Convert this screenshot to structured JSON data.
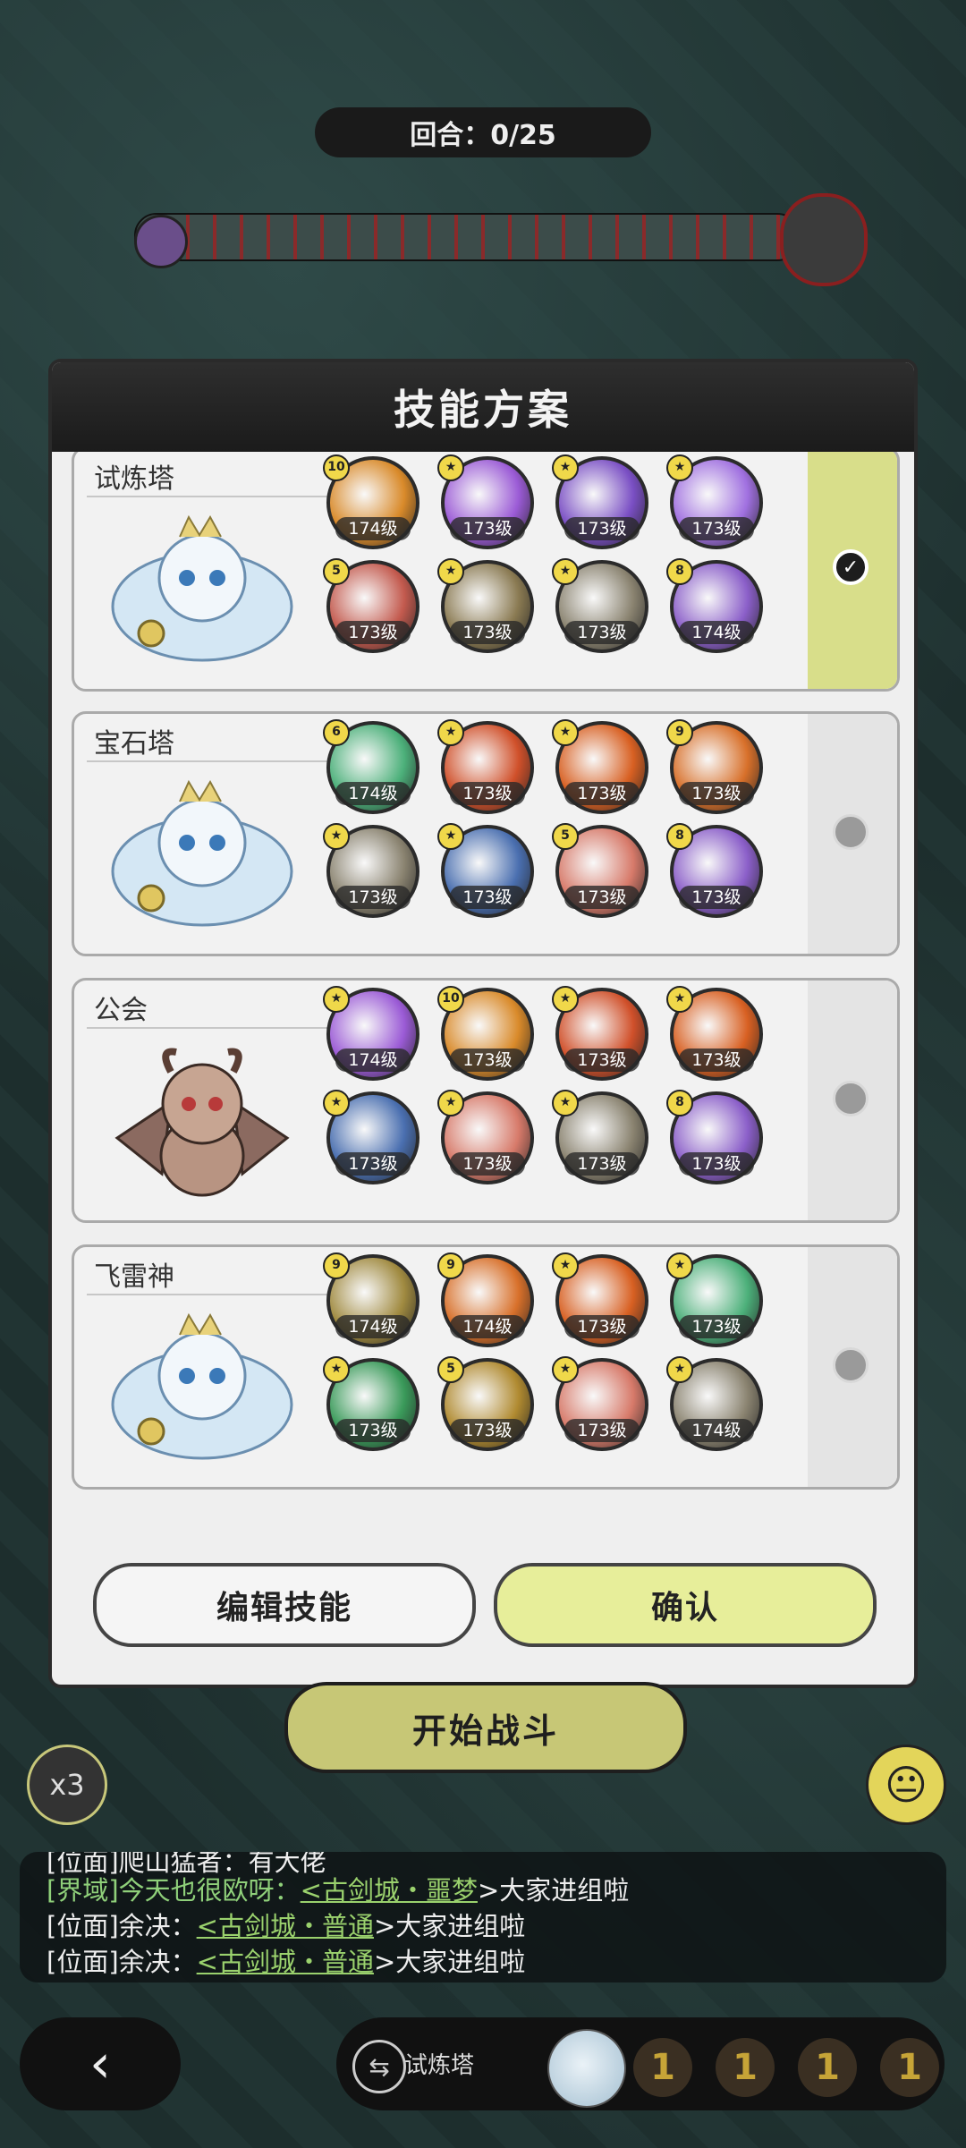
{
  "round": {
    "text": "回合：0/25"
  },
  "modal": {
    "title": "技能方案",
    "edit_label": "编辑技能",
    "confirm_label": "确认"
  },
  "plans": [
    {
      "name": "试炼塔",
      "selected": true,
      "pet": "white-dragon",
      "skills": [
        {
          "lvl": "174级",
          "star": "10",
          "color": "#d98a2a"
        },
        {
          "lvl": "173级",
          "star": "★",
          "color": "#9b5bd6"
        },
        {
          "lvl": "173级",
          "star": "★",
          "color": "#7a4fc4"
        },
        {
          "lvl": "173级",
          "star": "★",
          "color": "#a070e0"
        },
        {
          "lvl": "173级",
          "star": "5",
          "color": "#c35a4e"
        },
        {
          "lvl": "173级",
          "star": "★",
          "color": "#8a7a52"
        },
        {
          "lvl": "173级",
          "star": "★",
          "color": "#8a8370"
        },
        {
          "lvl": "174级",
          "star": "8",
          "color": "#8b5fc9"
        }
      ]
    },
    {
      "name": "宝石塔",
      "selected": false,
      "pet": "white-dragon",
      "skills": [
        {
          "lvl": "174级",
          "star": "6",
          "color": "#4cb07a"
        },
        {
          "lvl": "173级",
          "star": "★",
          "color": "#d0502a"
        },
        {
          "lvl": "173级",
          "star": "★",
          "color": "#d86022"
        },
        {
          "lvl": "173级",
          "star": "9",
          "color": "#d8702a"
        },
        {
          "lvl": "173级",
          "star": "★",
          "color": "#8a8370"
        },
        {
          "lvl": "173级",
          "star": "★",
          "color": "#4a6fb0"
        },
        {
          "lvl": "173级",
          "star": "5",
          "color": "#d77a6a"
        },
        {
          "lvl": "173级",
          "star": "8",
          "color": "#8b5fc9"
        }
      ]
    },
    {
      "name": "公会",
      "selected": false,
      "pet": "brown-dragon",
      "skills": [
        {
          "lvl": "174级",
          "star": "★",
          "color": "#9b5bd6"
        },
        {
          "lvl": "173级",
          "star": "10",
          "color": "#d98a2a"
        },
        {
          "lvl": "173级",
          "star": "★",
          "color": "#d0502a"
        },
        {
          "lvl": "173级",
          "star": "★",
          "color": "#d86022"
        },
        {
          "lvl": "173级",
          "star": "★",
          "color": "#4a6fb0"
        },
        {
          "lvl": "173级",
          "star": "★",
          "color": "#d77a6a"
        },
        {
          "lvl": "173级",
          "star": "★",
          "color": "#8a8370"
        },
        {
          "lvl": "173级",
          "star": "8",
          "color": "#8b5fc9"
        }
      ]
    },
    {
      "name": "飞雷神",
      "selected": false,
      "pet": "white-dragon",
      "skills": [
        {
          "lvl": "174级",
          "star": "9",
          "color": "#a08a40"
        },
        {
          "lvl": "174级",
          "star": "9",
          "color": "#d8702a"
        },
        {
          "lvl": "173级",
          "star": "★",
          "color": "#d86022"
        },
        {
          "lvl": "173级",
          "star": "★",
          "color": "#4cb07a"
        },
        {
          "lvl": "173级",
          "star": "★",
          "color": "#3a9a5a"
        },
        {
          "lvl": "173级",
          "star": "5",
          "color": "#b08a30"
        },
        {
          "lvl": "173级",
          "star": "★",
          "color": "#d77a6a"
        },
        {
          "lvl": "174级",
          "star": "★",
          "color": "#8a8370"
        }
      ]
    }
  ],
  "start_battle": "开始战斗",
  "speed": "x3",
  "chat": {
    "line0": "[位面]爬山猛者：有大佬",
    "line1_prefix": "[界域]今天也很欧呀：",
    "line1_link": "<古剑城・噩梦",
    "line1_end": ">大家进组啦",
    "line2_prefix": "[位面]余决：",
    "line2_link": "<古剑城・普通",
    "line2_end": ">大家进组啦",
    "line3_prefix": "[位面]余决：",
    "line3_link": "<古剑城・普通",
    "line3_end": ">大家进组啦"
  },
  "bottom": {
    "tower_label": "试炼塔",
    "slots": [
      "1",
      "1",
      "1",
      "1"
    ]
  }
}
